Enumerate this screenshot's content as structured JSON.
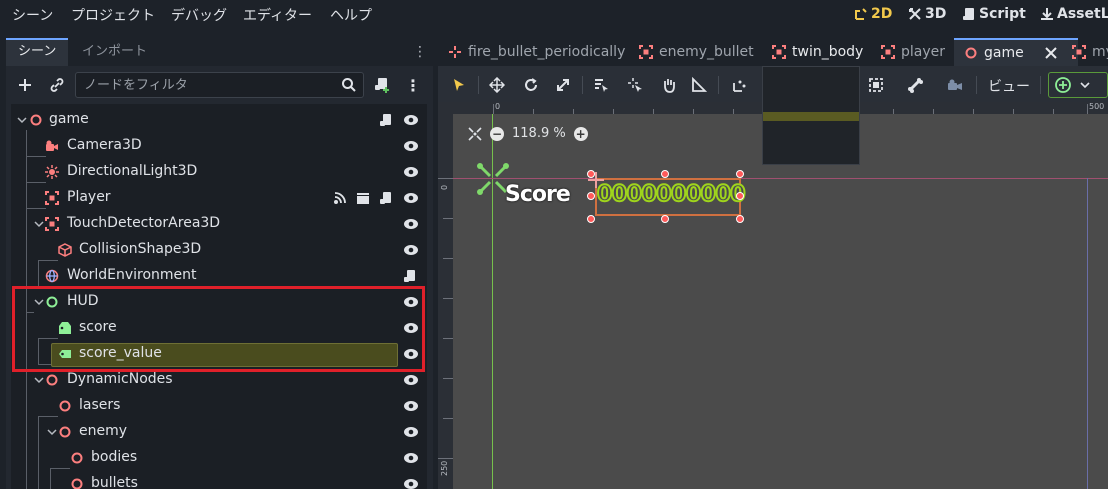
{
  "menu": {
    "items": [
      "シーン",
      "プロジェクト",
      "デバッグ",
      "エディター",
      "ヘルプ"
    ],
    "modes": [
      "2D",
      "3D",
      "Script",
      "AssetLib"
    ],
    "active_mode": "2D"
  },
  "dock": {
    "tabs": [
      "シーン",
      "インポート"
    ],
    "filter_placeholder": "ノードをフィルタ"
  },
  "tree": [
    {
      "label": "game",
      "icon": "node3d-circle-icon",
      "color": "#fc7f7f"
    },
    {
      "label": "Camera3D",
      "icon": "camera-icon",
      "color": "#fc7f7f"
    },
    {
      "label": "DirectionalLight3D",
      "icon": "sun-icon",
      "color": "#fc7f7f"
    },
    {
      "label": "Player",
      "icon": "scene-instance-icon",
      "color": "#fc7f7f"
    },
    {
      "label": "TouchDetectorArea3D",
      "icon": "scene-instance-icon",
      "color": "#fc7f7f"
    },
    {
      "label": "CollisionShape3D",
      "icon": "cube-icon",
      "color": "#fc7f7f"
    },
    {
      "label": "WorldEnvironment",
      "icon": "globe-icon",
      "color": "#fc7f7f"
    },
    {
      "label": "HUD",
      "icon": "control-circle-icon",
      "color": "#8eef97"
    },
    {
      "label": "score",
      "icon": "label-icon",
      "color": "#8eef97"
    },
    {
      "label": "score_value",
      "icon": "label-icon",
      "color": "#8eef97"
    },
    {
      "label": "DynamicNodes",
      "icon": "node3d-circle-icon",
      "color": "#fc7f7f"
    },
    {
      "label": "lasers",
      "icon": "node3d-circle-icon",
      "color": "#fc7f7f"
    },
    {
      "label": "enemy",
      "icon": "node3d-circle-icon",
      "color": "#fc7f7f"
    },
    {
      "label": "bodies",
      "icon": "node3d-circle-icon",
      "color": "#fc7f7f"
    },
    {
      "label": "bullets",
      "icon": "node3d-circle-icon",
      "color": "#fc7f7f"
    }
  ],
  "editor": {
    "tabs": [
      "fire_bullet_periodically",
      "enemy_bullet",
      "twin_body",
      "player",
      "game",
      "my"
    ],
    "active_tab": "game",
    "view_menu": "ビュー",
    "zoom": "118.9 %",
    "ruler_top": [
      "0",
      "500"
    ],
    "ruler_left": [
      "0",
      "250"
    ]
  },
  "canvas": {
    "score_label": "Score",
    "score_value": "0000000000"
  },
  "colors": {
    "accent": "#6ea5ff",
    "mode_active": "#f2c94c",
    "node3d": "#fc7f7f",
    "control": "#8eef97",
    "highlight": "#e0202a",
    "score_value_text": "#9fd51c"
  }
}
